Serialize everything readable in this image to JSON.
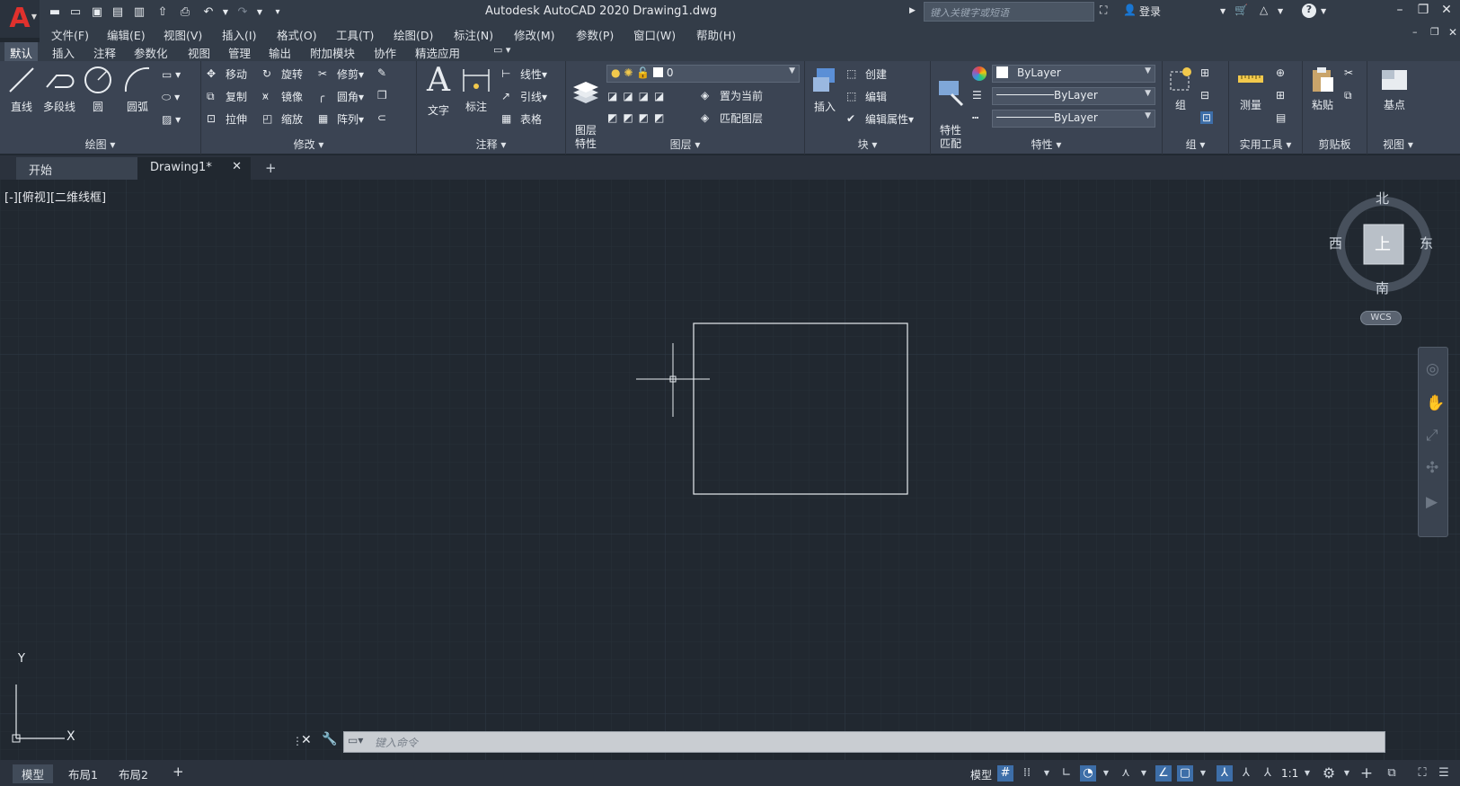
{
  "window": {
    "title": "Autodesk AutoCAD 2020    Drawing1.dwg",
    "search_placeholder": "键入关键字或短语",
    "login": "登录"
  },
  "menu": [
    "文件(F)",
    "编辑(E)",
    "视图(V)",
    "插入(I)",
    "格式(O)",
    "工具(T)",
    "绘图(D)",
    "标注(N)",
    "修改(M)",
    "参数(P)",
    "窗口(W)",
    "帮助(H)"
  ],
  "ribbon_tabs": [
    "默认",
    "插入",
    "注释",
    "参数化",
    "视图",
    "管理",
    "输出",
    "附加模块",
    "协作",
    "精选应用"
  ],
  "ribbon": {
    "draw": {
      "label": "绘图",
      "tools": [
        "直线",
        "多段线",
        "圆",
        "圆弧"
      ]
    },
    "modify": {
      "label": "修改",
      "tools": [
        "移动",
        "旋转",
        "修剪",
        "复制",
        "镜像",
        "圆角",
        "拉伸",
        "缩放",
        "阵列"
      ]
    },
    "annotation": {
      "label": "注释",
      "tools": [
        "文字",
        "标注",
        "线性",
        "引线",
        "表格"
      ]
    },
    "layers": {
      "label": "图层",
      "big": "图层\n特性",
      "layer_value": "0",
      "tools": [
        "置为当前",
        "匹配图层"
      ]
    },
    "block": {
      "label": "块",
      "tools": [
        "插入",
        "创建",
        "编辑",
        "编辑属性"
      ]
    },
    "properties": {
      "label": "特性",
      "big": "特性\n匹配",
      "color": "ByLayer",
      "linetype": "ByLayer",
      "lineweight": "ByLayer"
    },
    "group": {
      "label": "组",
      "tool": "组"
    },
    "utilities": {
      "label": "实用工具",
      "tool": "测量"
    },
    "clipboard": {
      "label": "剪贴板",
      "tool": "粘贴"
    },
    "view": {
      "label": "视图",
      "tool": "基点"
    }
  },
  "file_tabs": {
    "start": "开始",
    "doc": "Drawing1*"
  },
  "canvas": {
    "view_label": "[-][俯视][二维线框]",
    "viewcube": {
      "north": "北",
      "south": "南",
      "east": "东",
      "west": "西",
      "top": "上",
      "wcs": "WCS"
    },
    "ucs": {
      "x": "X",
      "y": "Y"
    }
  },
  "command": {
    "placeholder": "键入命令"
  },
  "layout_tabs": [
    "模型",
    "布局1",
    "布局2"
  ],
  "status": {
    "model": "模型",
    "scale": "1:1"
  },
  "colors": {
    "accent": "#e0312d",
    "background": "#212830",
    "ribbon": "#3b4453",
    "status_on": "#3d6ea8"
  }
}
